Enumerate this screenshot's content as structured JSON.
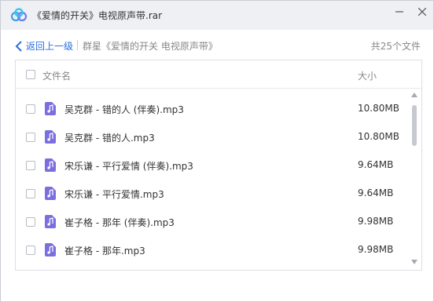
{
  "window": {
    "title": "《爱情的开关》电视原声带.rar",
    "icons": {
      "logo": "baidu-netdisk-cloud-icon",
      "minimize": "minimize-icon",
      "close": "close-icon"
    }
  },
  "nav": {
    "back_label": "返回上一级",
    "breadcrumb": "群星《爱情的开关 电视原声带》",
    "file_count": "共25个文件"
  },
  "list": {
    "header": {
      "name": "文件名",
      "size": "大小"
    },
    "rows": [
      {
        "name": "吴克群 - 错的人 (伴奏).mp3",
        "size": "10.80MB",
        "icon": "music-file-icon"
      },
      {
        "name": "吴克群 - 错的人.mp3",
        "size": "10.80MB",
        "icon": "music-file-icon"
      },
      {
        "name": "宋乐谦 - 平行爱情 (伴奏).mp3",
        "size": "9.64MB",
        "icon": "music-file-icon"
      },
      {
        "name": "宋乐谦 - 平行爱情.mp3",
        "size": "9.64MB",
        "icon": "music-file-icon"
      },
      {
        "name": "崔子格 - 那年 (伴奏).mp3",
        "size": "9.98MB",
        "icon": "music-file-icon"
      },
      {
        "name": "崔子格 - 那年.mp3",
        "size": "9.98MB",
        "icon": "music-file-icon"
      }
    ]
  },
  "colors": {
    "accent": "#2f6fd8",
    "file_icon": "#7b6fe0",
    "titlebar": "#eef0f4"
  }
}
